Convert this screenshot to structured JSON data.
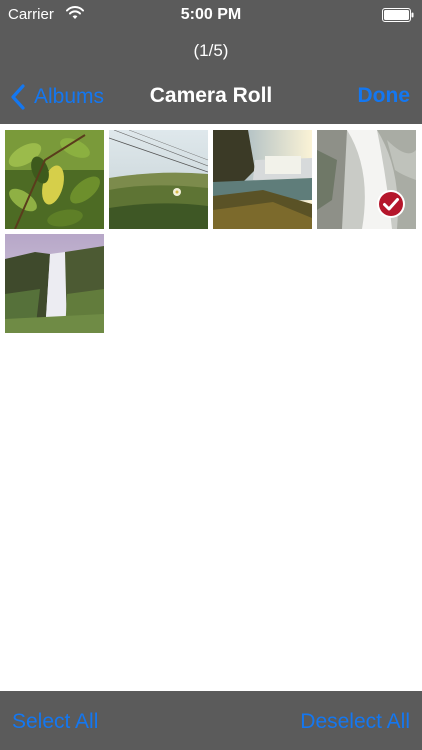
{
  "status_bar": {
    "carrier": "Carrier",
    "time": "5:00 PM",
    "wifi_icon": "wifi-icon",
    "battery_icon": "battery-icon"
  },
  "header": {
    "counter": "(1/5)",
    "back_label": "Albums",
    "title": "Camera Roll",
    "done_label": "Done"
  },
  "photos": [
    {
      "name": "photo-leaves",
      "selected": false
    },
    {
      "name": "photo-wires-grass",
      "selected": false
    },
    {
      "name": "photo-falls-sunset",
      "selected": false
    },
    {
      "name": "photo-waterfall-grey",
      "selected": true
    },
    {
      "name": "photo-waterfall-cliff",
      "selected": false
    }
  ],
  "toolbar": {
    "select_all": "Select All",
    "deselect_all": "Deselect All"
  },
  "colors": {
    "bar_background": "#5b5b5b",
    "accent": "#1477f0",
    "checkmark": "#b5162b"
  }
}
